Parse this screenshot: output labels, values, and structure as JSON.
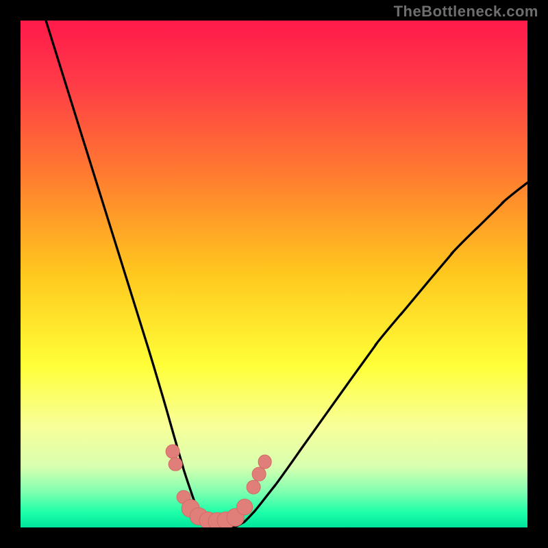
{
  "watermark": "TheBottleneck.com",
  "colors": {
    "black": "#000000",
    "curve": "#000000",
    "dot_fill": "#e07f7a",
    "dot_stroke": "#d36a64",
    "gradient_stops": [
      {
        "pct": 0,
        "color": "#ff1a4a"
      },
      {
        "pct": 12,
        "color": "#ff3a48"
      },
      {
        "pct": 30,
        "color": "#ff7a30"
      },
      {
        "pct": 50,
        "color": "#ffc81e"
      },
      {
        "pct": 68,
        "color": "#ffff38"
      },
      {
        "pct": 80,
        "color": "#f8ff99"
      },
      {
        "pct": 88,
        "color": "#d8ffb0"
      },
      {
        "pct": 93,
        "color": "#7fffb0"
      },
      {
        "pct": 97,
        "color": "#1effa9"
      },
      {
        "pct": 100,
        "color": "#00e59c"
      }
    ]
  },
  "chart_data": {
    "type": "line",
    "title": "",
    "xlabel": "",
    "ylabel": "",
    "xlim": [
      0,
      100
    ],
    "ylim": [
      0,
      100
    ],
    "series": [
      {
        "name": "bottleneck-curve",
        "x": [
          5,
          10,
          15,
          20,
          25,
          28,
          30,
          32,
          34,
          35,
          36,
          38,
          40,
          42,
          44,
          46,
          50,
          55,
          60,
          65,
          70,
          75,
          80,
          85,
          90,
          95,
          100
        ],
        "values": [
          100,
          84,
          68,
          52,
          36,
          26,
          19,
          12,
          6,
          3,
          1,
          0,
          0,
          0,
          1,
          3,
          8,
          15,
          22,
          29,
          36,
          42,
          48,
          54,
          59,
          64,
          68
        ]
      }
    ],
    "points": [
      {
        "name": "left-upper-1",
        "x": 30.0,
        "y": 15.0,
        "r": 1.4
      },
      {
        "name": "left-upper-2",
        "x": 30.6,
        "y": 12.5,
        "r": 1.4
      },
      {
        "name": "left-lower-1",
        "x": 32.2,
        "y": 6.0,
        "r": 1.4
      },
      {
        "name": "marker-b1",
        "x": 33.5,
        "y": 3.8,
        "r": 1.8
      },
      {
        "name": "marker-b2",
        "x": 35.2,
        "y": 2.2,
        "r": 1.8
      },
      {
        "name": "marker-b3",
        "x": 37.0,
        "y": 1.4,
        "r": 1.8
      },
      {
        "name": "marker-b4",
        "x": 38.8,
        "y": 1.2,
        "r": 1.8
      },
      {
        "name": "marker-b5",
        "x": 40.6,
        "y": 1.4,
        "r": 1.8
      },
      {
        "name": "marker-b6",
        "x": 42.4,
        "y": 2.0,
        "r": 1.8
      },
      {
        "name": "right-lower-1",
        "x": 44.2,
        "y": 4.0,
        "r": 1.6
      },
      {
        "name": "right-upper-1",
        "x": 46.0,
        "y": 8.0,
        "r": 1.4
      },
      {
        "name": "right-upper-2",
        "x": 47.0,
        "y": 10.5,
        "r": 1.4
      },
      {
        "name": "right-upper-3",
        "x": 48.2,
        "y": 13.0,
        "r": 1.4
      }
    ]
  }
}
